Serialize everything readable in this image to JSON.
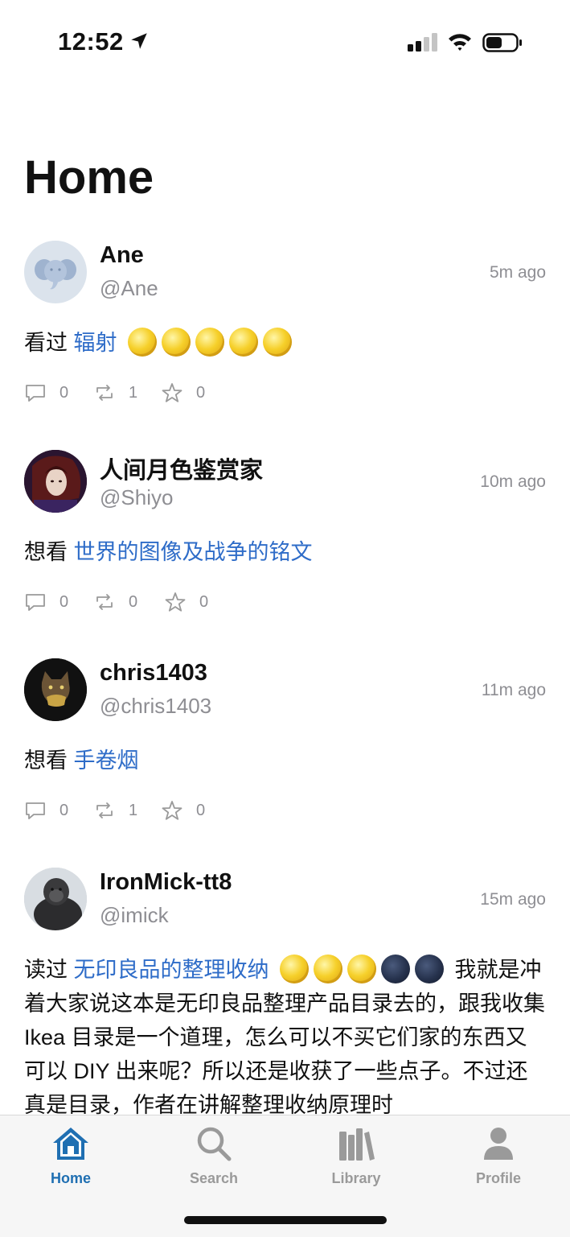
{
  "status_bar": {
    "time": "12:52"
  },
  "page": {
    "title": "Home"
  },
  "posts": [
    {
      "name": "Ane",
      "handle": "@Ane",
      "time": "5m ago",
      "verb": "看过",
      "book": "辐射",
      "rating": {
        "full": 5,
        "empty": 0
      },
      "text": "",
      "counts": {
        "comments": "0",
        "reposts": "1",
        "stars": "0"
      }
    },
    {
      "name": "人间月色鉴赏家",
      "handle": "@Shiyo",
      "time": "10m ago",
      "verb": "想看",
      "book": "世界的图像及战争的铭文",
      "rating": null,
      "text": "",
      "counts": {
        "comments": "0",
        "reposts": "0",
        "stars": "0"
      }
    },
    {
      "name": "chris1403",
      "handle": "@chris1403",
      "time": "11m ago",
      "verb": "想看",
      "book": "手卷烟",
      "rating": null,
      "text": "",
      "counts": {
        "comments": "0",
        "reposts": "1",
        "stars": "0"
      }
    },
    {
      "name": "IronMick-tt8",
      "handle": "@imick",
      "time": "15m ago",
      "verb": "读过",
      "book": "无印良品的整理收纳",
      "rating": {
        "full": 3,
        "empty": 2
      },
      "text": "我就是冲着大家说这本是无印良品整理产品目录去的，跟我收集 Ikea 目录是一个道理，怎么可以不买它们家的东西又可以 DIY 出来呢？所以还是收获了一些点子。不过还真是目录，作者在讲解整理收纳原理时"
    }
  ],
  "tabs": [
    {
      "label": "Home",
      "icon": "home-icon",
      "active": true
    },
    {
      "label": "Search",
      "icon": "search-icon",
      "active": false
    },
    {
      "label": "Library",
      "icon": "library-icon",
      "active": false
    },
    {
      "label": "Profile",
      "icon": "profile-icon",
      "active": false
    }
  ],
  "colors": {
    "accent": "#1f6fb2",
    "link": "#2e6cc8",
    "secondary_text": "#8e8e93",
    "tab_bar_bg": "#f6f6f6"
  }
}
